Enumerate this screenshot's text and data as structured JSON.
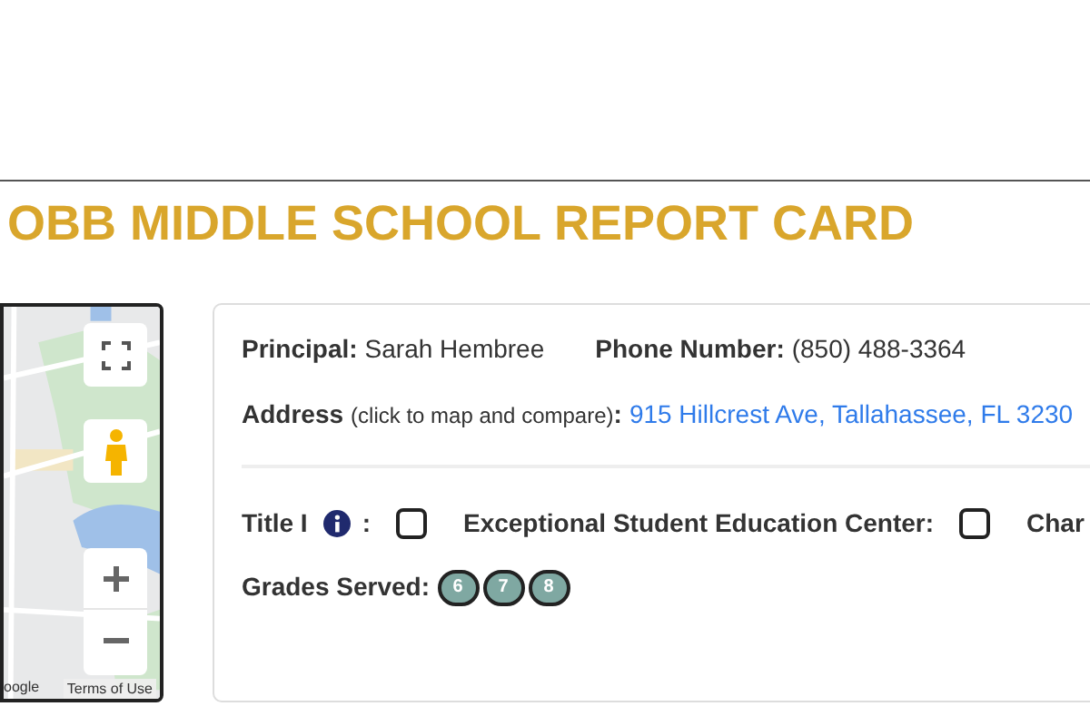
{
  "title": "OBB MIDDLE SCHOOL REPORT CARD",
  "map": {
    "attribution": "oogle",
    "terms": "Terms of Use"
  },
  "principal": {
    "label": "Principal:",
    "value": "Sarah Hembree"
  },
  "phone": {
    "label": "Phone Number:",
    "value": "(850) 488-3364"
  },
  "address": {
    "label": "Address",
    "hint": "(click to map and compare)",
    "colon": ":",
    "value": "915 Hillcrest Ave, Tallahassee, FL 3230"
  },
  "flags": [
    {
      "label": "Title I",
      "info": true,
      "colon": ":",
      "checked": false
    },
    {
      "label": "Exceptional Student Education Center:",
      "info": false,
      "checked": false
    },
    {
      "label": "Char",
      "info": false
    }
  ],
  "grades": {
    "label": "Grades Served:",
    "items": [
      "6",
      "7",
      "8"
    ]
  }
}
